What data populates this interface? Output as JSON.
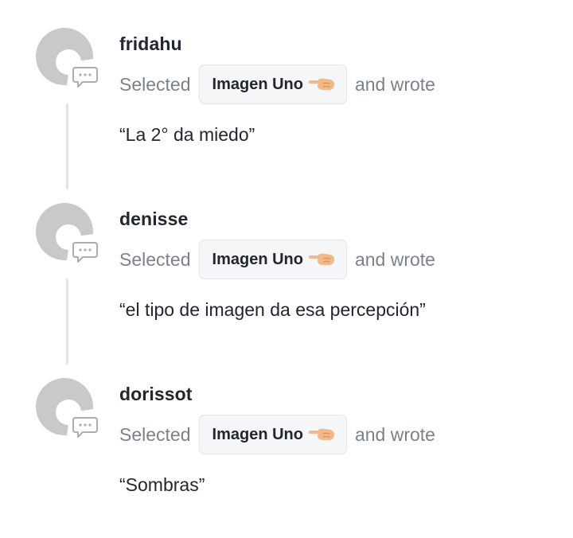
{
  "feed": {
    "entries": [
      {
        "username": "fridahu",
        "action_prefix": "Selected",
        "selection": "Imagen Uno",
        "action_suffix": "and wrote",
        "comment": "“La 2° da miedo”"
      },
      {
        "username": "denisse",
        "action_prefix": "Selected",
        "selection": "Imagen Uno",
        "action_suffix": "and wrote",
        "comment": "“el tipo de imagen da esa percepción”"
      },
      {
        "username": "dorissot",
        "action_prefix": "Selected",
        "selection": "Imagen Uno",
        "action_suffix": "and wrote",
        "comment": "“Sombras”"
      }
    ]
  },
  "icons": {
    "avatar": "default-avatar-icon",
    "comment": "speech-bubble-icon",
    "selection": "pointing-hand-icon"
  },
  "colors": {
    "avatar_gray": "#c9c9cc",
    "muted_text": "#7b818c",
    "chip_background": "#f5f6f8",
    "hand_skin": "#f2b98a"
  }
}
